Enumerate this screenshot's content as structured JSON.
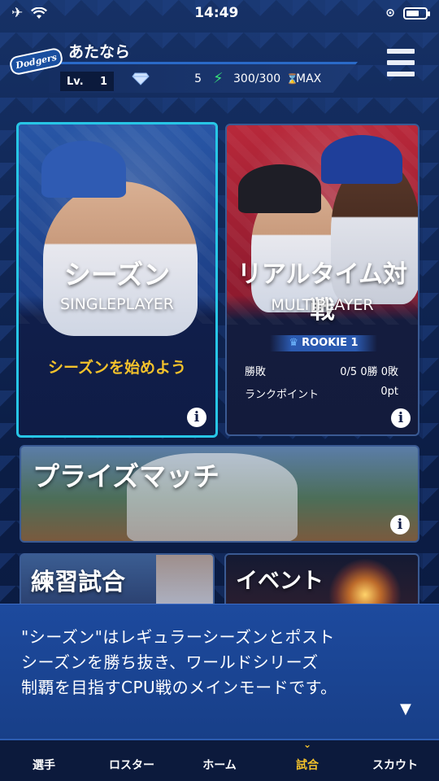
{
  "status_bar": {
    "time": "14:49"
  },
  "header": {
    "team_logo_text": "Dodgers",
    "player_name": "あたなら",
    "level_label": "Lv.",
    "level_value": "1",
    "gems": "5",
    "stamina": "300/300",
    "stamina_time": "MAX"
  },
  "cards": {
    "season": {
      "title": "シーズン",
      "subtitle": "SINGLEPLAYER",
      "cta": "シーズンを始めよう"
    },
    "realtime": {
      "title": "リアルタイム対戦",
      "subtitle": "MULTIPLAYER",
      "rank": "ROOKIE 1",
      "stats": [
        {
          "label": "勝敗",
          "value": "0/5  0勝  0敗"
        },
        {
          "label": "ランクポイント",
          "value": "0pt"
        }
      ]
    },
    "prize": {
      "title": "プライズマッチ"
    },
    "practice": {
      "title": "練習試合"
    },
    "event": {
      "title": "イベント"
    }
  },
  "tooltip": {
    "lines": [
      "\"シーズン\"はレギュラーシーズンとポスト",
      "シーズンを勝ち抜き、ワールドシリーズ",
      "制覇を目指すCPU戦のメインモードです。"
    ],
    "next_glyph": "▼"
  },
  "bottom_nav": [
    {
      "label": "選手"
    },
    {
      "label": "ロスター"
    },
    {
      "label": "ホーム"
    },
    {
      "label": "試合"
    },
    {
      "label": "スカウト"
    }
  ],
  "colors": {
    "accent_cyan": "#27c6e6",
    "highlight_yellow": "#f4c22b",
    "navy": "#0e2352",
    "stamina_green": "#37e07a"
  }
}
